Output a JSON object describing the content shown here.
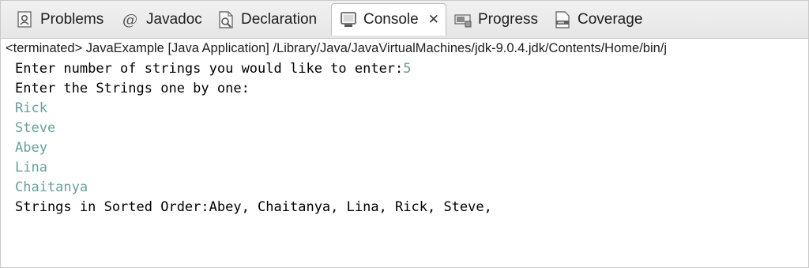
{
  "tabs": [
    {
      "label": "Problems",
      "icon": "problems-icon"
    },
    {
      "label": "Javadoc",
      "icon": "javadoc-icon"
    },
    {
      "label": "Declaration",
      "icon": "declaration-icon"
    },
    {
      "label": "Console",
      "icon": "console-icon",
      "active": true,
      "close": "✕"
    },
    {
      "label": "Progress",
      "icon": "progress-icon"
    },
    {
      "label": "Coverage",
      "icon": "coverage-icon"
    }
  ],
  "javadoc_glyph": "@",
  "status": "<terminated> JavaExample [Java Application] /Library/Java/JavaVirtualMachines/jdk-9.0.4.jdk/Contents/Home/bin/j",
  "console": {
    "prompt1": "Enter number of strings you would like to enter:",
    "input_count": "5",
    "prompt2": "Enter the Strings one by one:",
    "inputs": [
      "Rick",
      "Steve",
      "Abey",
      "Lina",
      "Chaitanya"
    ],
    "result": "Strings in Sorted Order:Abey, Chaitanya, Lina, Rick, Steve,"
  },
  "colors": {
    "input_text": "#6b9e9a",
    "output_text": "#000000",
    "tabbar_bg": "#ececec"
  }
}
